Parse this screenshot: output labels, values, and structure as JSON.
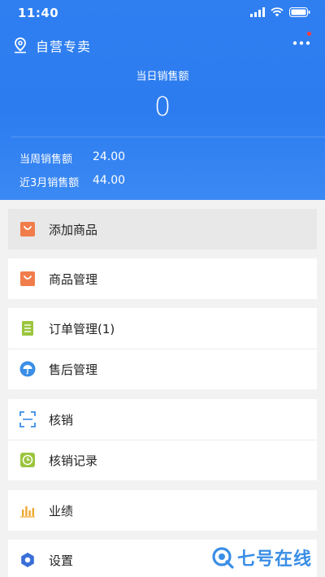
{
  "status_bar": {
    "time": "11:40"
  },
  "header": {
    "store_name": "自营专卖",
    "daily_sales_label": "当日销售额",
    "daily_sales_value": "0",
    "weekly_label": "当周销售额",
    "weekly_value": "24.00",
    "quarter_label": "近3月销售额",
    "quarter_value": "44.00"
  },
  "menu": {
    "add_product": "添加商品",
    "product_management": "商品管理",
    "order_management": "订单管理(1)",
    "after_sales": "售后管理",
    "verification": "核销",
    "verification_records": "核销记录",
    "performance": "业绩",
    "settings": "设置"
  },
  "watermark": {
    "text": "七号在线"
  },
  "colors": {
    "header_blue": "#2f7ff1",
    "orange_icon": "#f07d4b",
    "green_icon": "#9bc53d",
    "blue_icon": "#3a8ee6",
    "badge_red": "#ff3b3b"
  }
}
